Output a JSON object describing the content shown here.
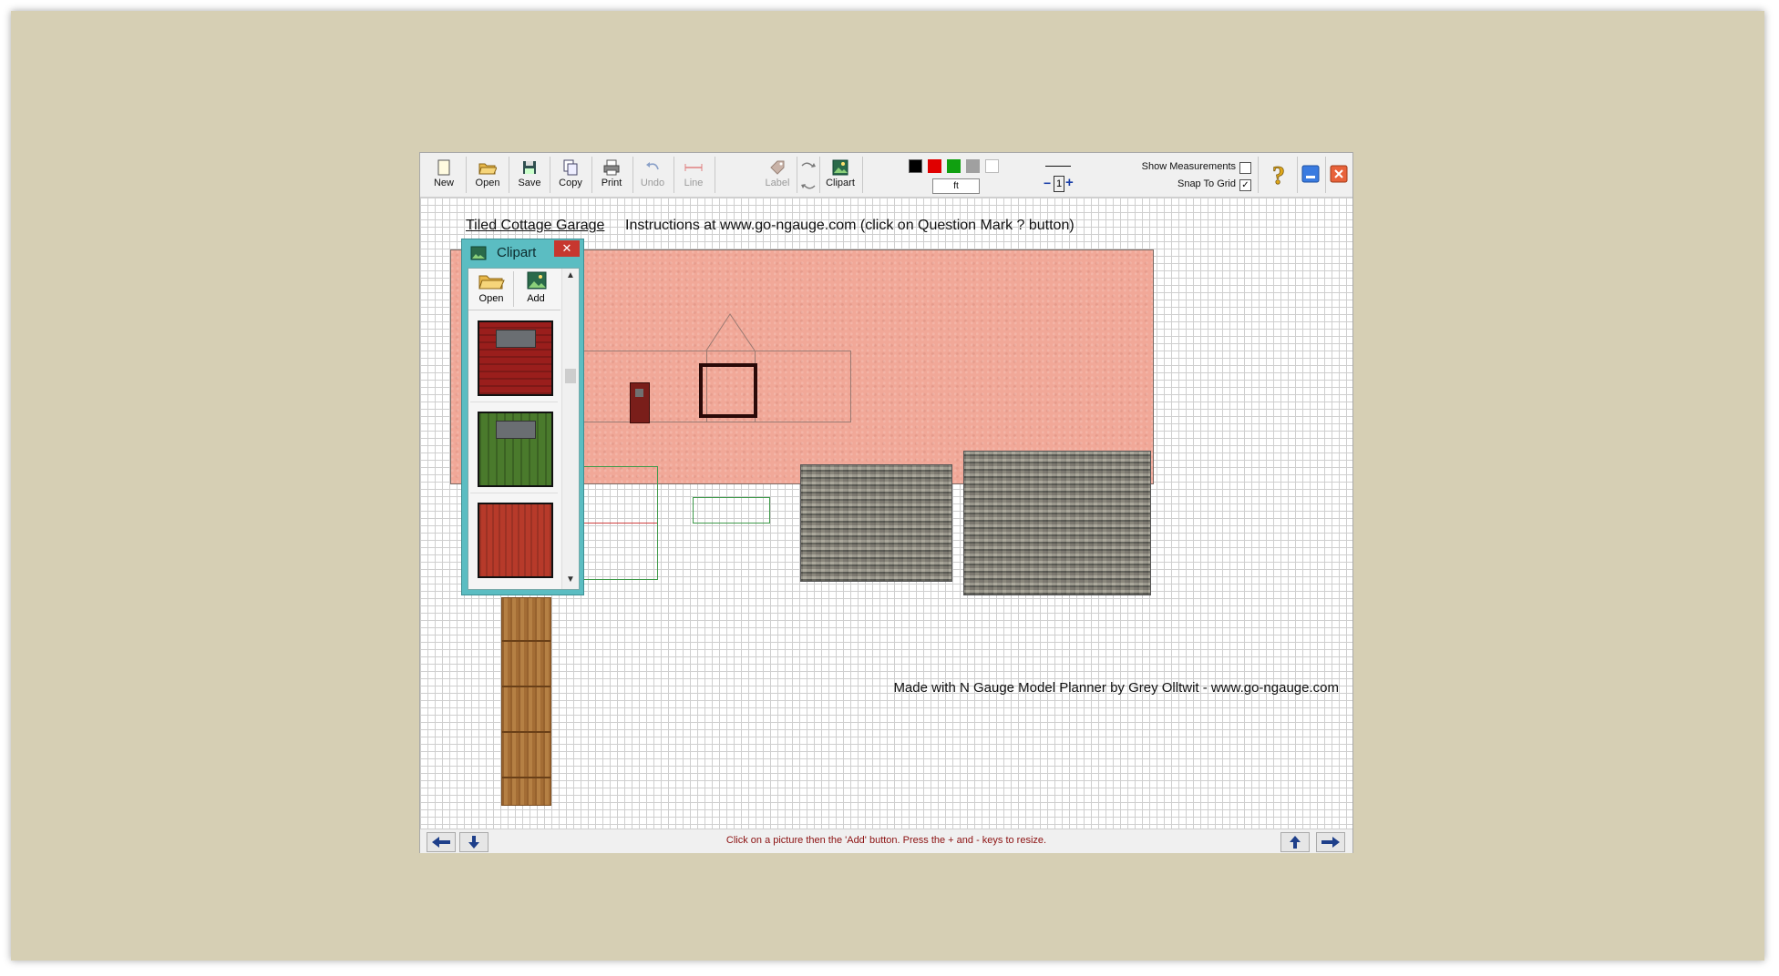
{
  "toolbar": {
    "buttons": [
      {
        "label": "New",
        "icon": "new-document-icon"
      },
      {
        "label": "Open",
        "icon": "open-folder-icon"
      },
      {
        "label": "Save",
        "icon": "floppy-disk-icon"
      },
      {
        "label": "Copy",
        "icon": "copy-icon"
      },
      {
        "label": "Print",
        "icon": "printer-icon"
      },
      {
        "label": "Undo",
        "icon": "undo-icon",
        "disabled": true
      },
      {
        "label": "Line",
        "icon": "line-tool-icon",
        "disabled": true
      },
      {
        "label": "Label",
        "icon": "label-tag-icon",
        "disabled": true
      },
      {
        "label": "Clipart",
        "icon": "clipart-picture-icon"
      }
    ],
    "colors": [
      "#000000",
      "#e00000",
      "#10a010",
      "#a0a0a0",
      "#ffffff"
    ],
    "unit": "ft",
    "zoom_value": "1",
    "show_measurements_label": "Show Measurements",
    "show_measurements_checked": false,
    "snap_to_grid_label": "Snap To Grid",
    "snap_to_grid_checked": true,
    "snap_check_mark": "✓"
  },
  "canvas": {
    "project_title": "Tiled Cottage Garage",
    "instructions": "Instructions at www.go-ngauge.com (click on Question Mark ? button)",
    "credit": "Made with N Gauge Model Planner by Grey Olltwit - www.go-ngauge.com"
  },
  "clipart": {
    "title": "Clipart",
    "close_glyph": "✕",
    "open_label": "Open",
    "add_label": "Add",
    "thumbnails": [
      "red-door-thumbnail",
      "green-door-thumbnail",
      "red-panel-thumbnail"
    ]
  },
  "status": {
    "message": "Click on a picture then the 'Add' button. Press the + and - keys to resize."
  },
  "colors": {
    "desktop": "#d6cfb4",
    "wall": "#f1a898",
    "clip_frame": "#5bbdc2",
    "status_text": "#8b1010"
  }
}
